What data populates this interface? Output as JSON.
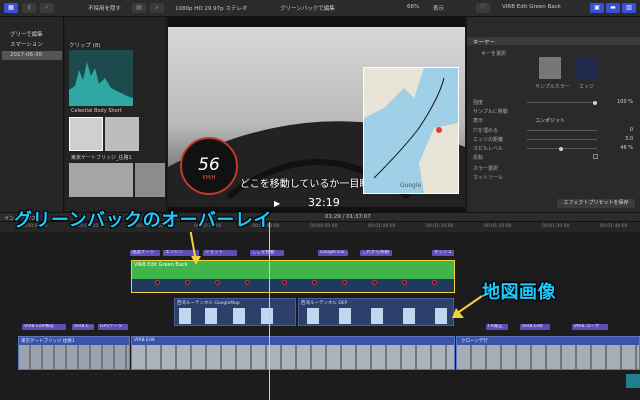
{
  "toolbar": {
    "sort_label": "不採用を隠す",
    "format_label": "1080p HD 29.97p ステレオ",
    "project_title": "グリーンバックで編集",
    "zoom": "66%",
    "view_label": "表示",
    "inspector_title": "VIRB Edit Green Back"
  },
  "sidebar": {
    "items": [
      {
        "label": "グリーで編集"
      },
      {
        "label": "スマーション"
      },
      {
        "label": "2017-06-30"
      }
    ]
  },
  "browser": {
    "header": "クリップ",
    "count": "(8)",
    "clips": [
      {
        "label": "Celestial Body Short"
      },
      {
        "label": "東京ゲートブリッジ_往路1"
      }
    ]
  },
  "viewer": {
    "overlay_text": "どこを移動しているか一目瞭然",
    "speed": "56",
    "speed_unit": "KM/H",
    "timecode": "32:19",
    "map_logo": "Google"
  },
  "inspector": {
    "section_keyer": "キーヤー",
    "subsection": "キーを選択",
    "sample_color_label": "サンプルカラー",
    "edge_label": "エッジ",
    "strength_label": "強度",
    "strength_value": "100 %",
    "jump_label": "サンプルに移動",
    "view_label": "表示",
    "view_value": "コンポジット",
    "fill_label": "穴を埋める",
    "fill_value": "0",
    "edge_dist_label": "エッジの距離",
    "edge_dist_value": "3.0",
    "spill_label": "スピルレベル",
    "spill_value": "46 %",
    "invert_label": "反転",
    "color_sel_label": "カラー選択",
    "matte_label": "マットツール",
    "save_preset": "エフェクトプリセットを保存"
  },
  "timeline": {
    "index_label": "インデックス",
    "position": "01:29 / 01:37:07",
    "ruler_ticks": [
      "00:00:00:00",
      "00:00:10:00",
      "00:00:20:00",
      "00:00:30:00",
      "00:00:40:00",
      "00:00:50:00",
      "00:01:00:00",
      "00:01:10:00",
      "00:01:20:00",
      "00:01:30:00",
      "00:01:40:00"
    ],
    "top_chips": [
      "速度ゲージ",
      "エンジン",
      "ショット",
      "ここを移動",
      "Google Ear...",
      "これから移動",
      "ダッシュ"
    ],
    "green_clip": "VIRB Edit Green Back",
    "map_clip_a": "西湾ルーテンネル GoogleMap",
    "map_clip_b": "西湾ルーテンネル DEP",
    "bottom_chips": [
      "VIRB Edit事前",
      "VIRB E...",
      "GPSデータ",
      "FX補正",
      "VIRB Edit",
      "VIRB ユーザ"
    ],
    "main_clip_a": "東京ゲートブリッジ 往路1",
    "main_clip_b": "VIRB Edit",
    "main_clip_c": "クローンデ行"
  },
  "callouts": {
    "overlay": "グリーンバックのオーバーレイ",
    "map": "地図画像"
  },
  "colors": {
    "accent": "#1ec9ff",
    "green_clip": "#3fb54b",
    "chip": "#5b4fb8",
    "arrow": "#f4d03f"
  }
}
